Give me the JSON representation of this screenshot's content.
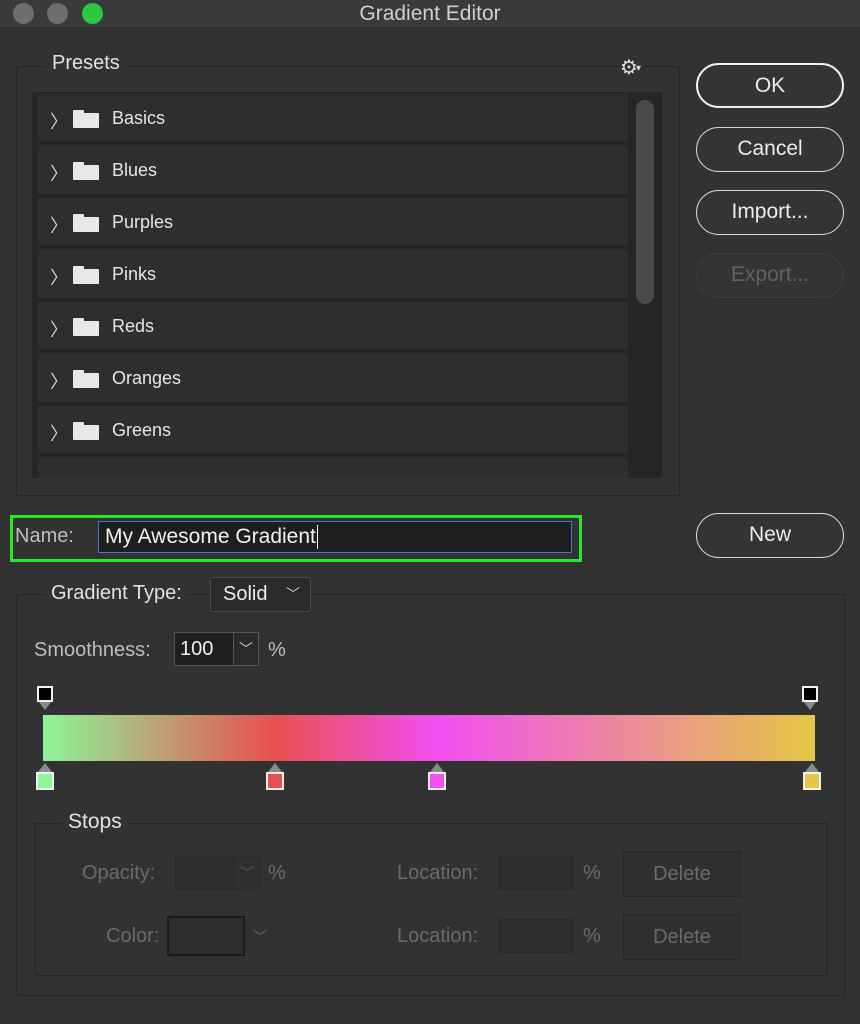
{
  "window": {
    "title": "Gradient Editor"
  },
  "presets": {
    "label": "Presets",
    "menu_icon": "gear-icon",
    "items": [
      {
        "label": "Basics"
      },
      {
        "label": "Blues"
      },
      {
        "label": "Purples"
      },
      {
        "label": "Pinks"
      },
      {
        "label": "Reds"
      },
      {
        "label": "Oranges"
      },
      {
        "label": "Greens"
      }
    ]
  },
  "buttons": {
    "ok": "OK",
    "cancel": "Cancel",
    "import": "Import...",
    "export": "Export...",
    "new": "New"
  },
  "name": {
    "label": "Name:",
    "value": "My Awesome Gradient"
  },
  "gradient": {
    "type_label": "Gradient Type:",
    "type_value": "Solid",
    "smoothness_label": "Smoothness:",
    "smoothness_value": "100",
    "smoothness_unit": "%",
    "color_stops": [
      {
        "color": "#8ef59a",
        "location": 0
      },
      {
        "color": "#e85050",
        "location": 30
      },
      {
        "color": "#f24ff0",
        "location": 51
      },
      {
        "color": "#e5c746",
        "location": 100
      }
    ],
    "opacity_stops": [
      {
        "location": 0
      },
      {
        "location": 100
      }
    ]
  },
  "stops": {
    "label": "Stops",
    "opacity_label": "Opacity:",
    "color_label": "Color:",
    "location_label": "Location:",
    "percent": "%",
    "delete_label": "Delete"
  },
  "colors": {
    "highlight": "#29e82a",
    "focus": "#3b7bd6",
    "maximize": "#2bc840"
  }
}
